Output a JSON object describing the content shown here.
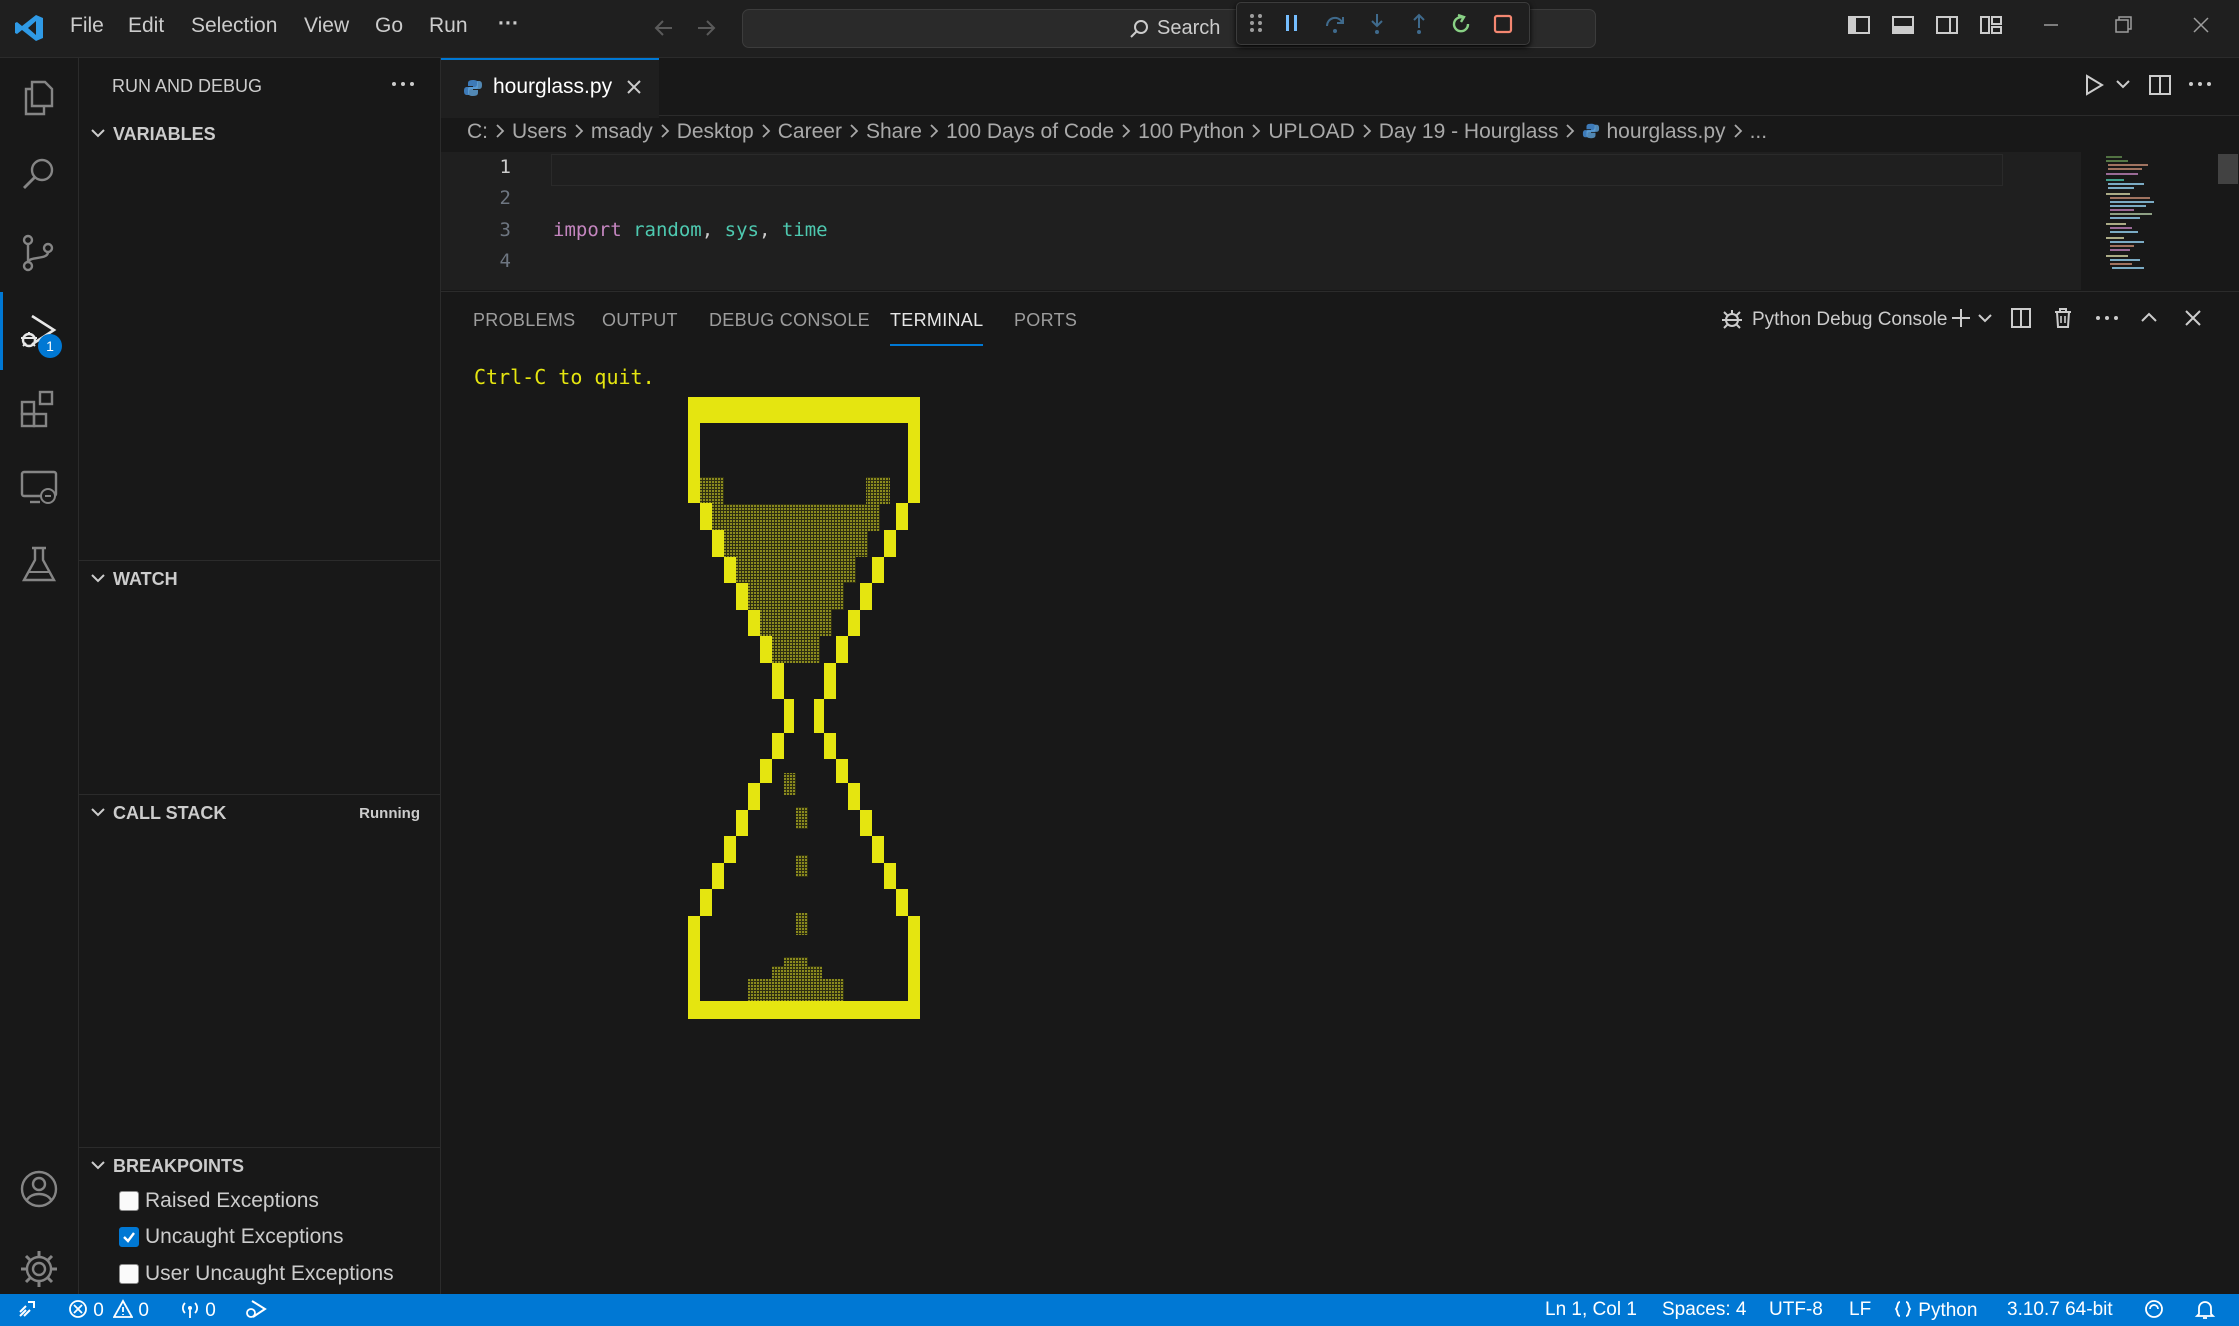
{
  "titlebar": {
    "menus": [
      "File",
      "Edit",
      "Selection",
      "View",
      "Go",
      "Run",
      "···"
    ],
    "search_label": "Search"
  },
  "sidebar": {
    "title": "RUN AND DEBUG",
    "sections": {
      "variables": "VARIABLES",
      "watch": "WATCH",
      "call_stack": "CALL STACK",
      "call_stack_status": "Running",
      "breakpoints": "BREAKPOINTS"
    },
    "breakpoints": [
      {
        "label": "Raised Exceptions",
        "checked": false
      },
      {
        "label": "Uncaught Exceptions",
        "checked": true
      },
      {
        "label": "User Uncaught Exceptions",
        "checked": false
      }
    ],
    "debug_badge": "1"
  },
  "editor": {
    "tab_label": "hourglass.py",
    "breadcrumb": [
      "C:",
      "Users",
      "msady",
      "Desktop",
      "Career",
      "Share",
      "100 Days of Code",
      "100 Python",
      "UPLOAD",
      "Day 19 - Hourglass",
      "hourglass.py",
      "..."
    ],
    "line_numbers": [
      "1",
      "2",
      "3",
      "4"
    ],
    "line3": {
      "kw": "import",
      "mod1": "random",
      "sep1": ", ",
      "mod2": "sys",
      "sep2": ", ",
      "mod3": "time"
    }
  },
  "panel": {
    "tabs": [
      "PROBLEMS",
      "OUTPUT",
      "DEBUG CONSOLE",
      "TERMINAL",
      "PORTS"
    ],
    "active_tab": "TERMINAL",
    "terminal_name": "Python Debug Console",
    "terminal_output": "Ctrl-C to quit."
  },
  "statusbar": {
    "errors": "0",
    "warnings": "0",
    "ports": "0",
    "position": "Ln 1, Col 1",
    "spaces": "Spaces: 4",
    "encoding": "UTF-8",
    "eol": "LF",
    "language": "Python",
    "interpreter": "3.10.7 64-bit"
  },
  "colors": {
    "accent": "#0078d4",
    "terminal_yellow": "#e5e510",
    "sand": "#6e6e16"
  }
}
